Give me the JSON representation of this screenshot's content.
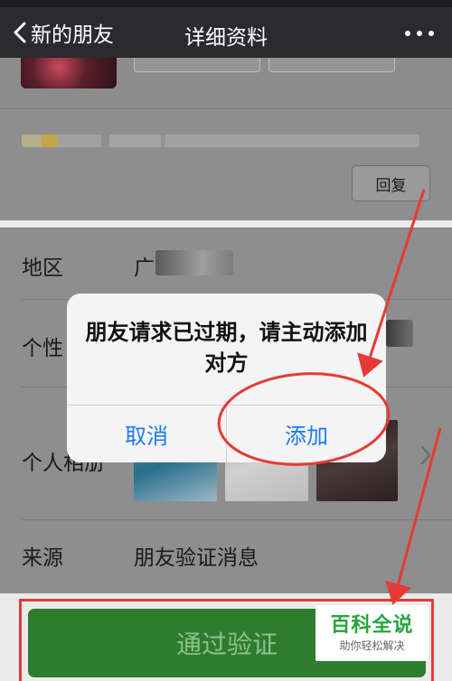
{
  "nav": {
    "back_label": "新的朋友",
    "title": "详细资料"
  },
  "message": {
    "reply_label": "回复"
  },
  "info": {
    "region_label": "地区",
    "region_value_visible": "广",
    "signature_label_partial": "个性",
    "album_label_partial": "个人相册",
    "source_label": "来源",
    "source_value": "朋友验证消息"
  },
  "actions": {
    "verify_label": "通过验证"
  },
  "modal": {
    "message": "朋友请求已过期，请主动添加对方",
    "cancel_label": "取消",
    "add_label": "添加"
  },
  "watermark": {
    "title": "百科全说",
    "subtitle": "助你轻松解决"
  },
  "colors": {
    "nav_bg": "#2b2b2f",
    "primary_green": "#2e7d2e",
    "dialog_button_blue": "#1b7cf6",
    "annotation_red": "#e53b34",
    "brand_green": "#24a63c"
  },
  "icons": {
    "back": "chevron-left-icon",
    "more": "more-icon",
    "row_arrow": "chevron-right-icon"
  }
}
